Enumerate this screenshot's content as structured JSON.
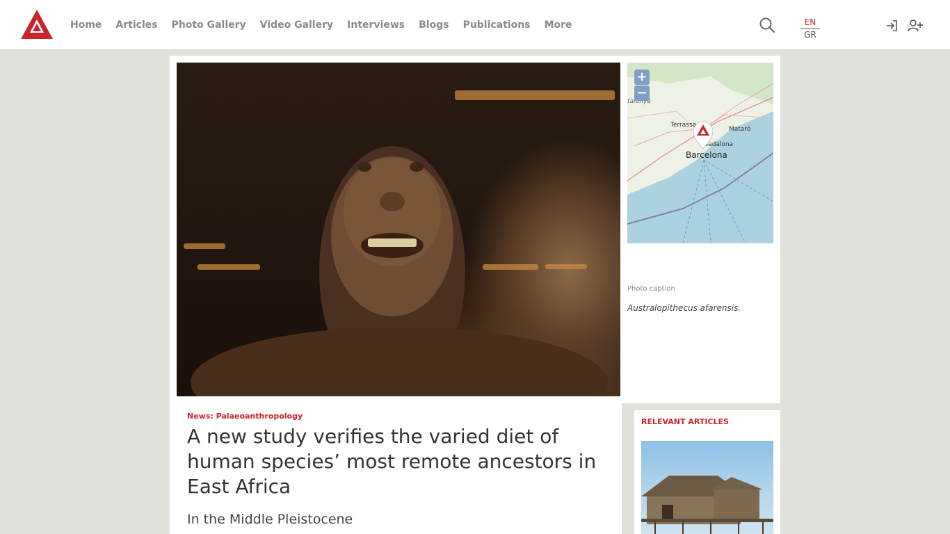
{
  "nav": {
    "items": [
      "Home",
      "Articles",
      "Photo Gallery",
      "Video Gallery",
      "Interviews",
      "Blogs",
      "Publications",
      "More"
    ]
  },
  "lang": {
    "en": "EN",
    "gr": "GR"
  },
  "map": {
    "labels": [
      "Terrassa",
      "Mataró",
      "Badalona",
      "Barcelona",
      "talunya"
    ]
  },
  "photo": {
    "caption_label": "Photo caption",
    "caption_text": "Australopithecus afarensis."
  },
  "article": {
    "category": "News: Palaeoanthropology",
    "title": "A new study verifies the varied diet of human species’ most remote ancestors in East Africa",
    "subtitle": "In the Middle Pleistocene"
  },
  "relevant": {
    "label": "RELEVANT ARTICLES"
  },
  "colors": {
    "accent": "#c9252c",
    "nav_text": "#8a8a8a",
    "background": "#e2e2dd"
  },
  "icons": {
    "search": "search-icon",
    "login": "login-icon",
    "register": "add-user-icon"
  }
}
